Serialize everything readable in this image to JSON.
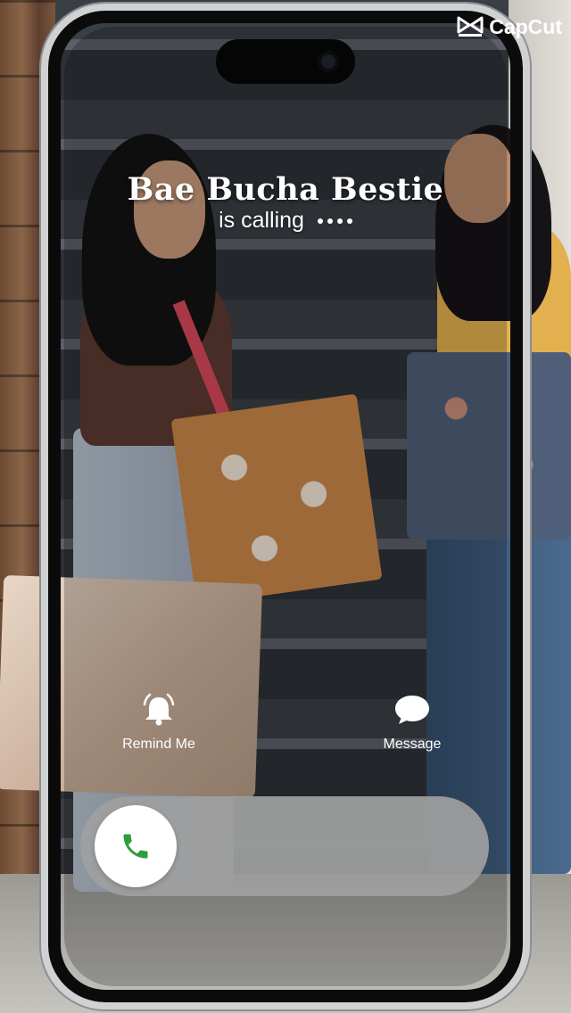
{
  "watermark": {
    "label": "CapCut"
  },
  "call": {
    "caller_name": "Bae Bucha Bestie",
    "status": "is calling"
  },
  "actions": {
    "remind": {
      "label": "Remind Me",
      "icon": "bell-icon"
    },
    "message": {
      "label": "Message",
      "icon": "speech-bubble-icon"
    }
  },
  "answer": {
    "icon": "phone-icon",
    "accent_color": "#2e9e3e"
  },
  "colors": {
    "text": "#ffffff",
    "slider_track": "#a0a0a0",
    "knob": "#ffffff"
  }
}
